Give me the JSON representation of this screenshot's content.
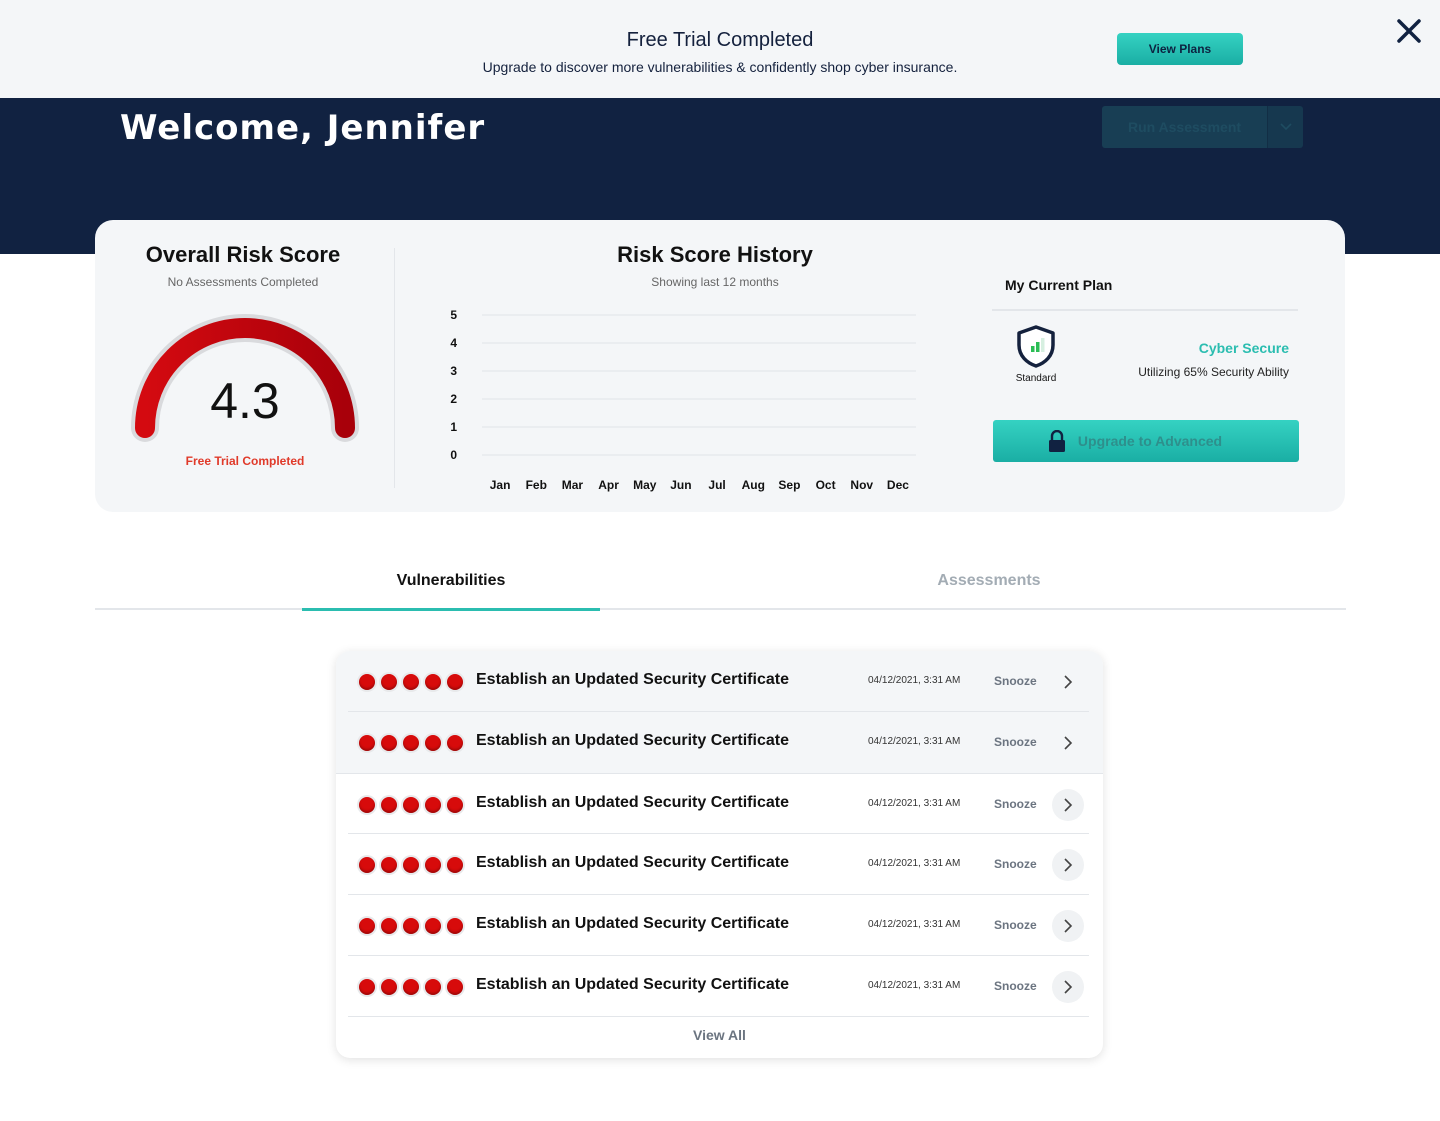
{
  "banner": {
    "title": "Free Trial Completed",
    "subtitle": "Upgrade to discover more vulnerabilities & confidently shop cyber insurance.",
    "cta_label": "View Plans",
    "close_icon": "close-icon"
  },
  "hero": {
    "welcome": "Welcome, Jennifer",
    "run_label": "Run Assessment",
    "caret_icon": "chevron-down-icon"
  },
  "risk": {
    "title": "Overall Risk Score",
    "subtitle": "No Assessments Completed",
    "score": "4.3",
    "score_value": 4.3,
    "status": "Free Trial Completed",
    "colors": {
      "gauge": "#c4000a",
      "status": "#e03a2a"
    }
  },
  "history": {
    "title": "Risk Score History",
    "subtitle": "Showing last 12 months"
  },
  "chart_data": {
    "type": "line",
    "categories": [
      "Jan",
      "Feb",
      "Mar",
      "Apr",
      "May",
      "Jun",
      "Jul",
      "Aug",
      "Sep",
      "Oct",
      "Nov",
      "Dec"
    ],
    "series": [],
    "y_ticks": [
      0,
      1,
      2,
      3,
      4,
      5
    ],
    "ylim": [
      0,
      5
    ],
    "grid": true
  },
  "plan": {
    "title": "My Current Plan",
    "tier": "Standard",
    "name": "Cyber Secure",
    "usage": "Utilizing 65% Security Ability",
    "upgrade_label": "Upgrade to Advanced",
    "accent": "#2bbdb0"
  },
  "tabs": [
    {
      "label": "Vulnerabilities",
      "active": true
    },
    {
      "label": "Assessments",
      "active": false
    }
  ],
  "vulnerabilities": [
    {
      "title": "Establish an Updated Security Certificate",
      "date": "04/12/2021, 3:31 AM",
      "snooze": "Snooze",
      "severity": 5
    },
    {
      "title": "Establish an Updated Security Certificate",
      "date": "04/12/2021, 3:31 AM",
      "snooze": "Snooze",
      "severity": 5
    },
    {
      "title": "Establish an Updated Security Certificate",
      "date": "04/12/2021, 3:31 AM",
      "snooze": "Snooze",
      "severity": 5
    },
    {
      "title": "Establish an Updated Security Certificate",
      "date": "04/12/2021, 3:31 AM",
      "snooze": "Snooze",
      "severity": 5
    },
    {
      "title": "Establish an Updated Security Certificate",
      "date": "04/12/2021, 3:31 AM",
      "snooze": "Snooze",
      "severity": 5
    },
    {
      "title": "Establish an Updated Security Certificate",
      "date": "04/12/2021, 3:31 AM",
      "snooze": "Snooze",
      "severity": 5
    }
  ],
  "view_all_label": "View All"
}
